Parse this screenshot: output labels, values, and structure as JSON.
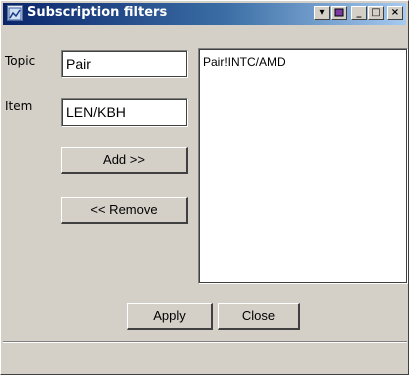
{
  "window": {
    "title": "Subscription filters",
    "buttons": {
      "pin": "▾",
      "minimize": "_",
      "maximize": "□",
      "close": "×"
    }
  },
  "form": {
    "topic_label": "Topic",
    "topic_value": "Pair",
    "item_label": "Item",
    "item_value": "LEN/KBH"
  },
  "actions": {
    "add_label": "Add >>",
    "remove_label": "<< Remove",
    "apply_label": "Apply",
    "close_label": "Close"
  },
  "subscriptions": [
    "Pair!INTC/AMD"
  ],
  "colors": {
    "title_gradient_start": "#0a246a",
    "title_gradient_end": "#a6caf0",
    "face": "#d4d0c8"
  }
}
